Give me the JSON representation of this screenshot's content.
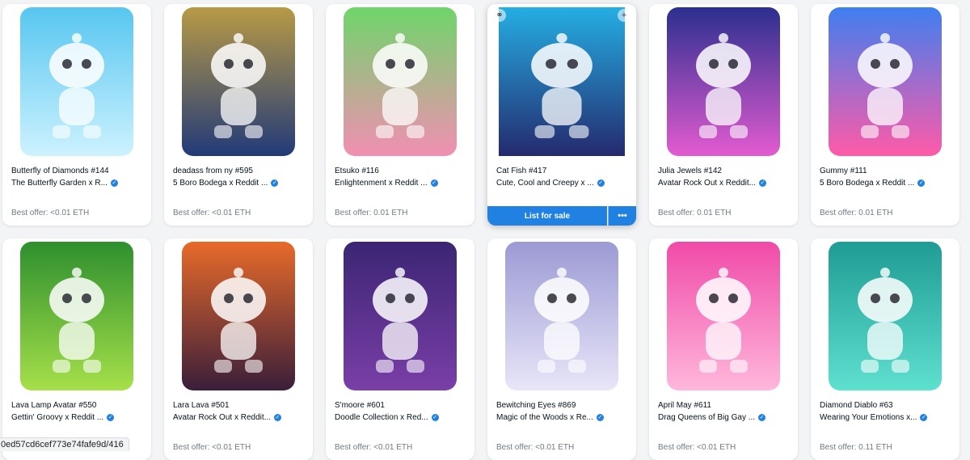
{
  "cards": [
    {
      "name": "Butterfly of Diamonds #144",
      "collection": "The Butterfly Garden x R...",
      "offer": "Best offer: <0.01 ETH",
      "verified": true,
      "art_colors": [
        "#57c6f0",
        "#cdf2ff"
      ]
    },
    {
      "name": "deadass from ny #595",
      "collection": "5 Boro Bodega x Reddit ...",
      "offer": "Best offer: <0.01 ETH",
      "verified": true,
      "art_colors": [
        "#b89a45",
        "#223a78"
      ]
    },
    {
      "name": "Etsuko #116",
      "collection": "Enlightenment x Reddit ...",
      "offer": "Best offer: 0.01 ETH",
      "verified": true,
      "art_colors": [
        "#6fd56a",
        "#f28fb2"
      ]
    },
    {
      "name": "Cat Fish #417",
      "collection": "Cute, Cool and Creepy x ...",
      "offer": "",
      "verified": true,
      "art_colors": [
        "#25aee3",
        "#242a6e"
      ]
    },
    {
      "name": "Julia Jewels #142",
      "collection": "Avatar Rock Out x Reddit...",
      "offer": "Best offer: 0.01 ETH",
      "verified": true,
      "art_colors": [
        "#2c2f8f",
        "#e25bd0"
      ]
    },
    {
      "name": "Gummy #111",
      "collection": "5 Boro Bodega x Reddit ...",
      "offer": "Best offer: 0.01 ETH",
      "verified": true,
      "art_colors": [
        "#3f7ff0",
        "#ff5aa8"
      ]
    },
    {
      "name": "Lava Lamp Avatar #550",
      "collection": "Gettin' Groovy x Reddit ...",
      "offer": "",
      "verified": true,
      "art_colors": [
        "#2e8f2e",
        "#a6e04a"
      ]
    },
    {
      "name": "Lara Lava #501",
      "collection": "Avatar Rock Out x Reddit...",
      "offer": "Best offer: <0.01 ETH",
      "verified": true,
      "art_colors": [
        "#e86a2a",
        "#3a1e3a"
      ]
    },
    {
      "name": "S'moore #601",
      "collection": "Doodle Collection x Red...",
      "offer": "Best offer: <0.01 ETH",
      "verified": true,
      "art_colors": [
        "#3b2573",
        "#7a3fa8"
      ]
    },
    {
      "name": "Bewitching Eyes #869",
      "collection": "Magic of the Woods x Re...",
      "offer": "Best offer: <0.01 ETH",
      "verified": true,
      "art_colors": [
        "#9c9ad4",
        "#e8e6f8"
      ]
    },
    {
      "name": "April May #611",
      "collection": "Drag Queens of Big Gay ...",
      "offer": "Best offer: <0.01 ETH",
      "verified": true,
      "art_colors": [
        "#f04aa8",
        "#ffb8dc"
      ]
    },
    {
      "name": "Diamond Diablo #63",
      "collection": "Wearing Your Emotions x...",
      "offer": "Best offer: 0.11 ETH",
      "verified": true,
      "art_colors": [
        "#1f9c94",
        "#5ee0cf"
      ]
    }
  ],
  "hover_card": {
    "list_label": "List for sale",
    "more_label": "•••"
  },
  "icons": {
    "link": "link-icon",
    "add": "plus-icon",
    "verified": "verified-badge-icon"
  },
  "status_bar": {
    "url": "0ed57cd6cef773e74fafe9d/416"
  },
  "colors": {
    "accent": "#2081e2",
    "muted": "#707a83"
  }
}
